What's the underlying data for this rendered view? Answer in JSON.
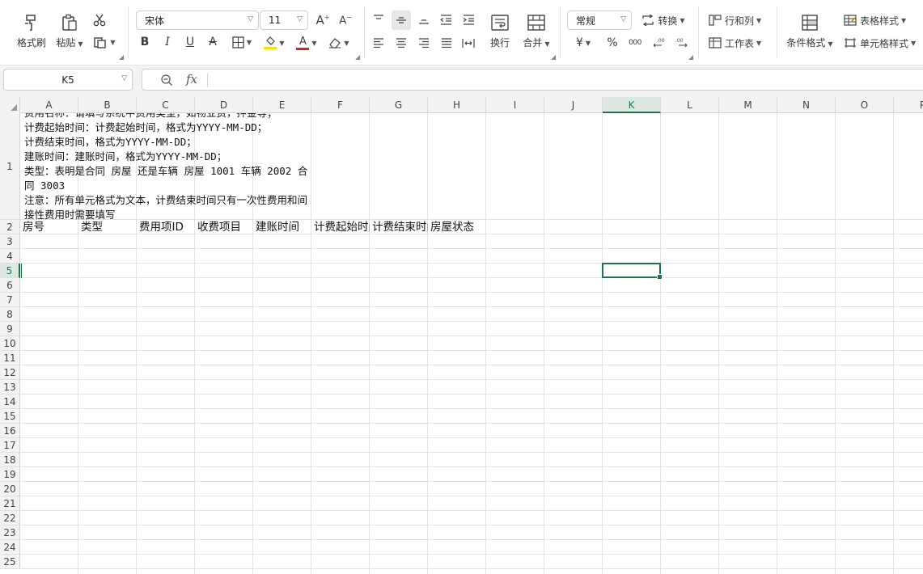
{
  "ribbon": {
    "format_painter": "格式刷",
    "paste": "粘贴",
    "font_name": "宋体",
    "font_size": "11",
    "wrap_text": "换行",
    "merge": "合并",
    "number_format": "常规",
    "convert": "转换",
    "rows_cols": "行和列",
    "worksheet": "工作表",
    "conditional_format": "条件格式",
    "table_style": "表格样式",
    "cell_style": "单元格样式",
    "currency_symbol": "¥",
    "percent_symbol": "%",
    "thousands_symbol": "000",
    "font_color": "#e02020",
    "highlight_color": "#f5e600"
  },
  "formula_bar": {
    "name_box": "K5",
    "fx": "fx",
    "formula": ""
  },
  "grid": {
    "columns": [
      "A",
      "B",
      "C",
      "D",
      "E",
      "F",
      "G",
      "H",
      "I",
      "J",
      "K",
      "L",
      "M",
      "N",
      "O",
      "P"
    ],
    "active_column": "K",
    "rows": [
      "1",
      "2",
      "3",
      "4",
      "5",
      "6",
      "7",
      "8",
      "9",
      "10",
      "11",
      "12",
      "13",
      "14",
      "15",
      "16",
      "17",
      "18",
      "19",
      "20",
      "21",
      "22",
      "23",
      "24",
      "25"
    ],
    "active_row": "5",
    "active_cell": "K5",
    "accent_color": "#217346",
    "a1_lines": [
      "费用名称：请填写系统中费用类型，如物业费，押金等；",
      "计费起始时间：计费起始时间，格式为YYYY-MM-DD；",
      "计费结束时间，格式为YYYY-MM-DD；",
      "建账时间：建账时间，格式为YYYY-MM-DD；",
      " 类型：表明是合同 房屋 还是车辆 房屋 1001 车辆 2002 合",
      "同 3003",
      "注意：所有单元格式为文本，计费结束时间只有一次性费用和间",
      "接性费用时需要填写"
    ],
    "row2": [
      "房号",
      "类型",
      "费用项ID",
      "收费项目",
      "建账时间",
      "计费起始时间",
      "计费结束时间",
      "房屋状态"
    ]
  }
}
